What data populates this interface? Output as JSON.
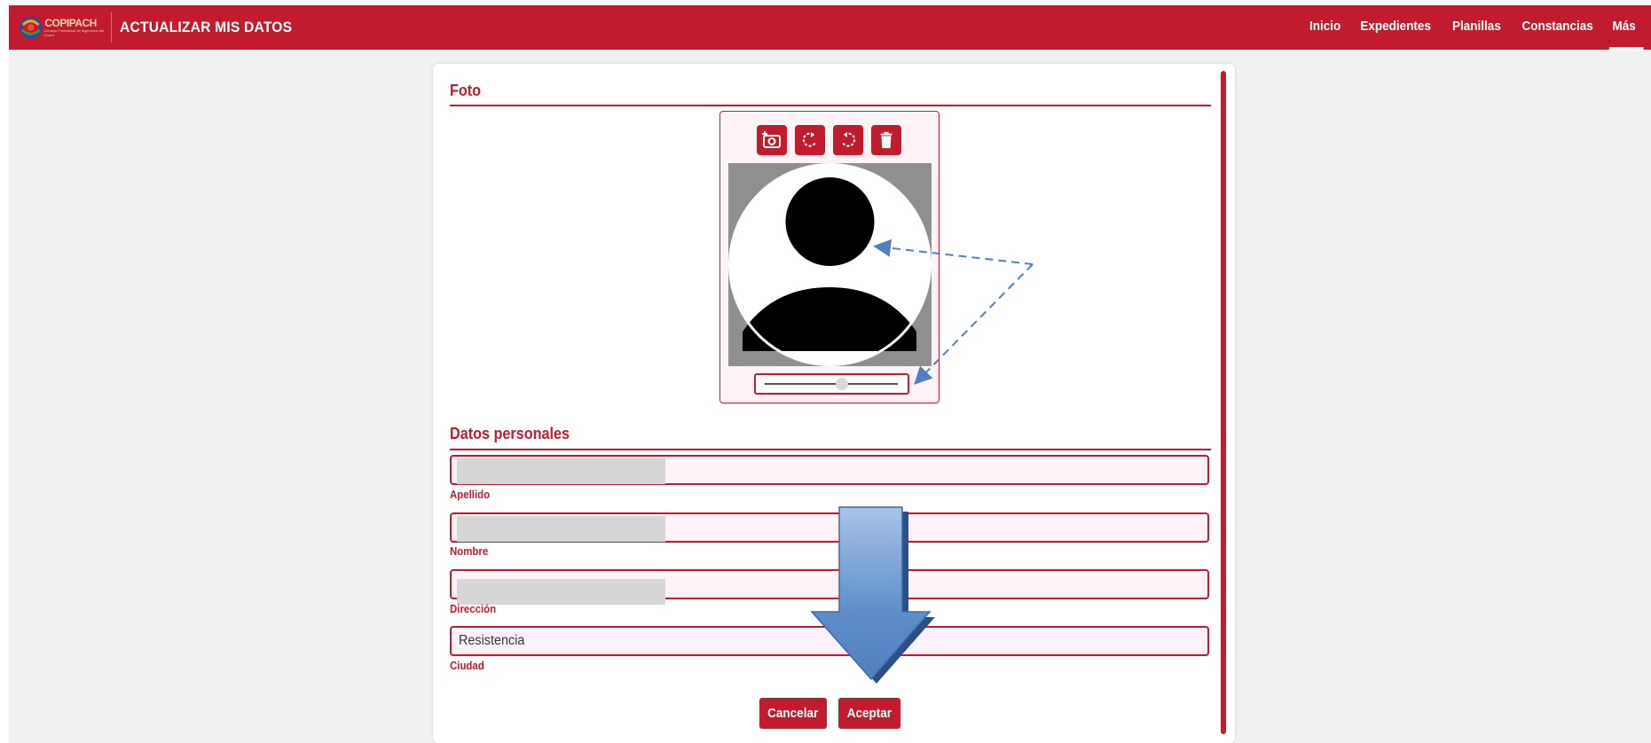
{
  "header": {
    "logo_text": "COPIPACH",
    "logo_subtitle": "Consejo Profesional de Ingenieros del Chaco",
    "title": "ACTUALIZAR MIS DATOS",
    "nav": [
      "Inicio",
      "Expedientes",
      "Planillas",
      "Constancias",
      "Más"
    ],
    "active_nav": "Más"
  },
  "photo_section": {
    "title": "Foto",
    "tools": [
      "camera-add-icon",
      "rotate-right-icon",
      "rotate-left-icon",
      "trash-icon"
    ],
    "zoom_slider_value": 0.58
  },
  "personal_section": {
    "title": "Datos personales",
    "fields": [
      {
        "label": "Apellido",
        "value": ""
      },
      {
        "label": "Nombre",
        "value": ""
      },
      {
        "label": "Dirección",
        "value": ""
      },
      {
        "label": "Ciudad",
        "value": "Resistencia"
      }
    ]
  },
  "actions": {
    "cancel_label": "Cancelar",
    "accept_label": "Aceptar"
  },
  "colors": {
    "brand": "#c01c2d",
    "annotation_arrow": "#4f7fbd"
  }
}
